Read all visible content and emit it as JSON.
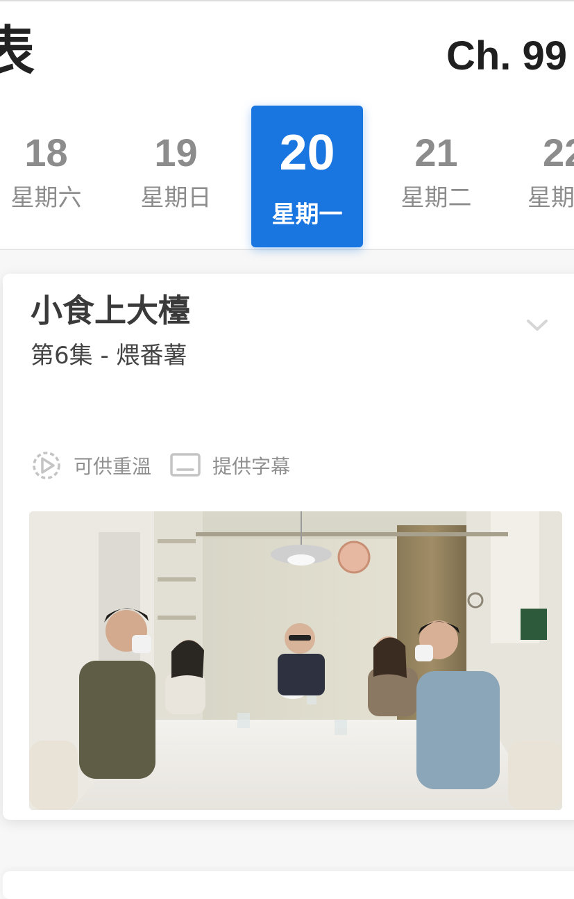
{
  "header": {
    "title_fragment": "表",
    "channel": "Ch. 99"
  },
  "date_tabs": [
    {
      "day": "18",
      "weekday": "星期六",
      "active": false
    },
    {
      "day": "19",
      "weekday": "星期日",
      "active": false
    },
    {
      "day": "20",
      "weekday": "星期一",
      "active": true
    },
    {
      "day": "21",
      "weekday": "星期二",
      "active": false
    },
    {
      "day": "22",
      "weekday": "星期",
      "active": false
    }
  ],
  "program": {
    "title": "小食上大檯",
    "episode": "第6集 - 煨番薯",
    "features": [
      {
        "icon": "replay-icon",
        "label": "可供重溫"
      },
      {
        "icon": "subtitle-icon",
        "label": "提供字幕"
      }
    ]
  },
  "colors": {
    "accent": "#1976e0",
    "muted_text": "#8c8c8c"
  }
}
